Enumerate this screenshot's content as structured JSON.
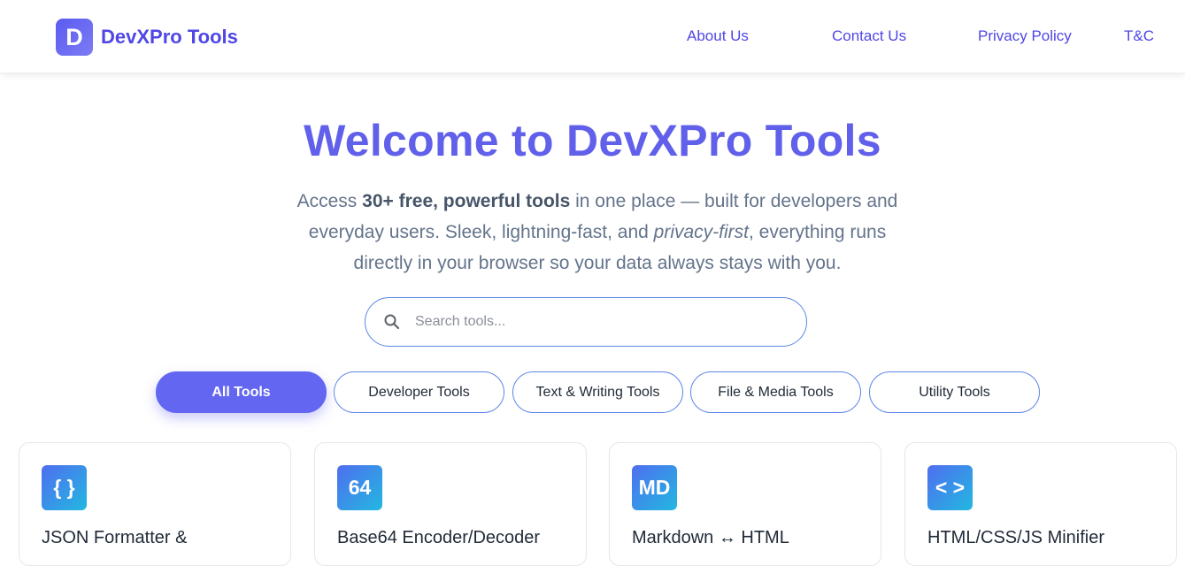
{
  "header": {
    "logo_letter": "D",
    "brand": "DevXPro Tools",
    "nav": [
      "About Us",
      "Contact Us",
      "Privacy Policy",
      "T&C"
    ]
  },
  "hero": {
    "title": "Welcome to DevXPro Tools",
    "desc_1": "Access ",
    "desc_bold": "30+ free, powerful tools",
    "desc_2": " in one place — built for developers and everyday users. Sleek, lightning-fast, and ",
    "desc_italic": "privacy-first",
    "desc_3": ", everything runs directly in your browser so your data always stays with you."
  },
  "search": {
    "placeholder": "Search tools...",
    "value": ""
  },
  "filters": [
    "All Tools",
    "Developer Tools",
    "Text & Writing Tools",
    "File & Media Tools",
    "Utility Tools"
  ],
  "active_filter": "All Tools",
  "tools": [
    {
      "icon": "{ }",
      "title": "JSON Formatter &"
    },
    {
      "icon": "64",
      "title": "Base64 Encoder/Decoder"
    },
    {
      "icon": "MD",
      "title": "Markdown ↔ HTML"
    },
    {
      "icon": "< >",
      "title": "HTML/CSS/JS Minifier"
    }
  ],
  "colors": {
    "brand": "#4f46e5",
    "hero_title": "#6160ea",
    "active_filter": "#6366f1",
    "border_accent": "#5b86e8"
  }
}
